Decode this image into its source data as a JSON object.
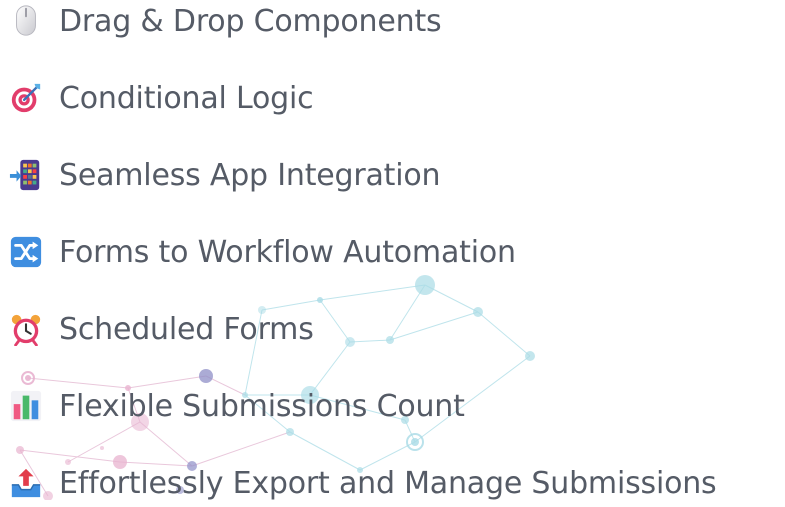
{
  "features": [
    {
      "label": "Drag & Drop Components",
      "icon": "computer-mouse-icon"
    },
    {
      "label": "Conditional Logic",
      "icon": "direct-hit-target-icon"
    },
    {
      "label": "Seamless App Integration",
      "icon": "mobile-phone-with-arrow-icon"
    },
    {
      "label": "Forms to Workflow Automation",
      "icon": "shuffle-tracks-icon"
    },
    {
      "label": "Scheduled Forms",
      "icon": "alarm-clock-icon"
    },
    {
      "label": "Flexible Submissions Count",
      "icon": "bar-chart-icon"
    },
    {
      "label": "Effortlessly Export and Manage Submissions",
      "icon": "outbox-tray-icon"
    }
  ],
  "colors": {
    "text": "#555b66",
    "network_blue": "#a9dbe6",
    "network_pink": "#e8b3cf",
    "network_purple": "#8f8fc7"
  }
}
